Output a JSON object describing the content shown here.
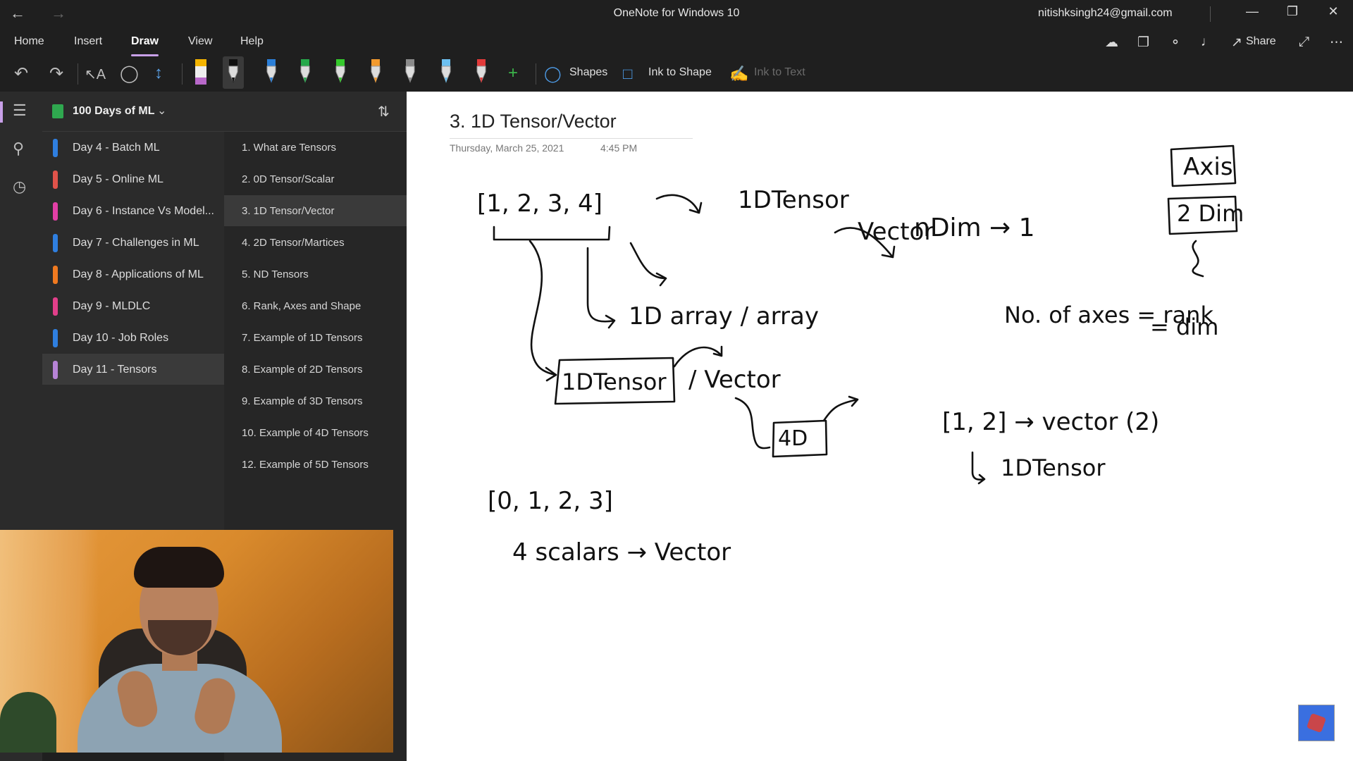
{
  "window": {
    "title": "OneNote for Windows 10",
    "account": "nitishksingh24@gmail.com"
  },
  "menu": {
    "tabs": [
      "Home",
      "Insert",
      "Draw",
      "View",
      "Help"
    ],
    "active": "Draw",
    "share_label": "Share"
  },
  "toolbar": {
    "shapes_label": "Shapes",
    "ink_to_shape_label": "Ink to Shape",
    "ink_to_text_label": "Ink to Text",
    "pens": [
      {
        "name": "highlighter",
        "color": "#b868c9"
      },
      {
        "name": "pen-black",
        "color": "#111111"
      },
      {
        "name": "pen-blue",
        "color": "#2b7fd8"
      },
      {
        "name": "pen-green",
        "color": "#25a84a"
      },
      {
        "name": "pen-bright-green",
        "color": "#35c92c"
      },
      {
        "name": "pen-orange",
        "color": "#f29a2e"
      },
      {
        "name": "pen-gray",
        "color": "#8a8a8a"
      },
      {
        "name": "pen-light-blue",
        "color": "#6cc0f0"
      },
      {
        "name": "pen-red",
        "color": "#e23a3a"
      }
    ]
  },
  "notebook": {
    "name": "100 Days of ML"
  },
  "sections": [
    {
      "label": "Day 4 - Batch ML",
      "color": "#2f7fe0"
    },
    {
      "label": "Day 5 - Online ML",
      "color": "#e0534a"
    },
    {
      "label": "Day 6 - Instance Vs Model...",
      "color": "#e23fa6"
    },
    {
      "label": "Day 7 - Challenges in ML",
      "color": "#2f7fe0"
    },
    {
      "label": "Day 8 - Applications of ML",
      "color": "#f07a20"
    },
    {
      "label": "Day 9 - MLDLC",
      "color": "#e23f8a"
    },
    {
      "label": "Day 10 - Job Roles",
      "color": "#2f7fe0"
    },
    {
      "label": "Day 11 - Tensors",
      "color": "#b784d6"
    }
  ],
  "selected_section": 7,
  "pages": [
    "1. What are Tensors",
    "2. 0D Tensor/Scalar",
    "3. 1D Tensor/Vector",
    "4. 2D Tensor/Martices",
    "5. ND Tensors",
    "6. Rank, Axes and Shape",
    "7. Example of 1D Tensors",
    "8. Example of 2D Tensors",
    "9. Example of 3D Tensors",
    "10. Example of 4D Tensors",
    "12. Example of 5D Tensors"
  ],
  "selected_page": 2,
  "note": {
    "title": "3. 1D Tensor/Vector",
    "date": "Thursday, March 25, 2021",
    "time": "4:45 PM",
    "ink": {
      "arr1": "[1, 2, 3, 4]",
      "one_d_tensor": "1DTensor",
      "vector": "Vector",
      "ndim": "nDim → 1",
      "array": "1D array / array",
      "box_tensor": "1DTensor",
      "slash_vector": "/ Vector",
      "four_d": "4D",
      "axis": "Axis",
      "two_dim": "2 Dim",
      "axes_rank": "No. of axes = rank",
      "eq_dim": "= dim",
      "arr2": "[1, 2] → vector (2)",
      "arr2_tensor": "1DTensor",
      "arr3": "[0, 1, 2, 3]",
      "scalars": "4 scalars → Vector"
    }
  }
}
